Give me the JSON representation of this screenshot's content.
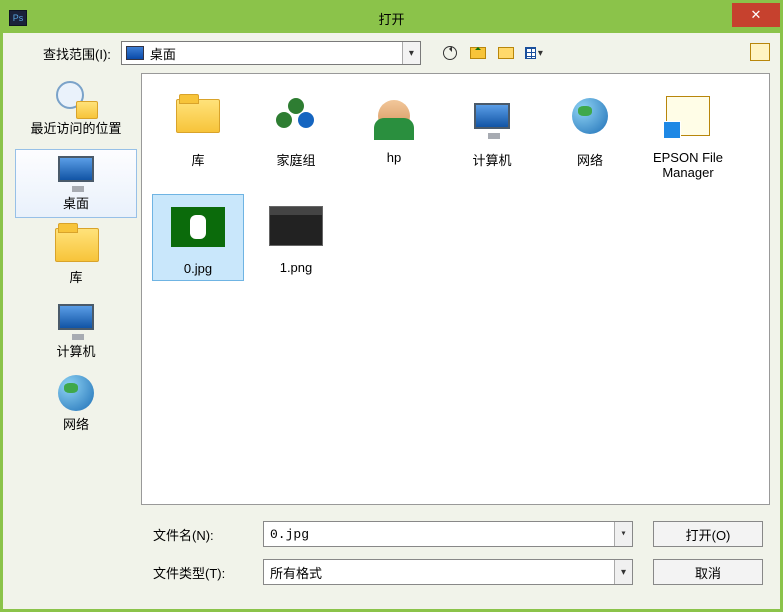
{
  "window": {
    "title": "打开",
    "app_icon_text": "Ps"
  },
  "toolbar": {
    "lookin_label": "查找范围(I):",
    "lookin_value": "桌面",
    "icons": {
      "back": "back-icon",
      "up": "up-one-level-icon",
      "new_folder": "new-folder-icon",
      "view": "view-menu-icon",
      "image_sequence": "image-sequence-icon"
    }
  },
  "sidebar": {
    "items": [
      {
        "label": "最近访问的位置",
        "id": "recent"
      },
      {
        "label": "桌面",
        "id": "desktop",
        "selected": true
      },
      {
        "label": "库",
        "id": "libraries"
      },
      {
        "label": "计算机",
        "id": "computer"
      },
      {
        "label": "网络",
        "id": "network"
      }
    ]
  },
  "files": {
    "row1": [
      {
        "label": "库",
        "kind": "libraries"
      },
      {
        "label": "家庭组",
        "kind": "homegroup"
      },
      {
        "label": "hp",
        "kind": "user"
      },
      {
        "label": "计算机",
        "kind": "computer"
      },
      {
        "label": "网络",
        "kind": "network"
      },
      {
        "label": "EPSON File Manager",
        "kind": "shortcut"
      }
    ],
    "row2": [
      {
        "label": "0.jpg",
        "kind": "img0",
        "selected": true
      },
      {
        "label": "1.png",
        "kind": "img1"
      }
    ]
  },
  "form": {
    "filename_label": "文件名(N):",
    "filename_value": "0.jpg",
    "filetype_label": "文件类型(T):",
    "filetype_value": "所有格式",
    "open_button": "打开(O)",
    "cancel_button": "取消"
  }
}
